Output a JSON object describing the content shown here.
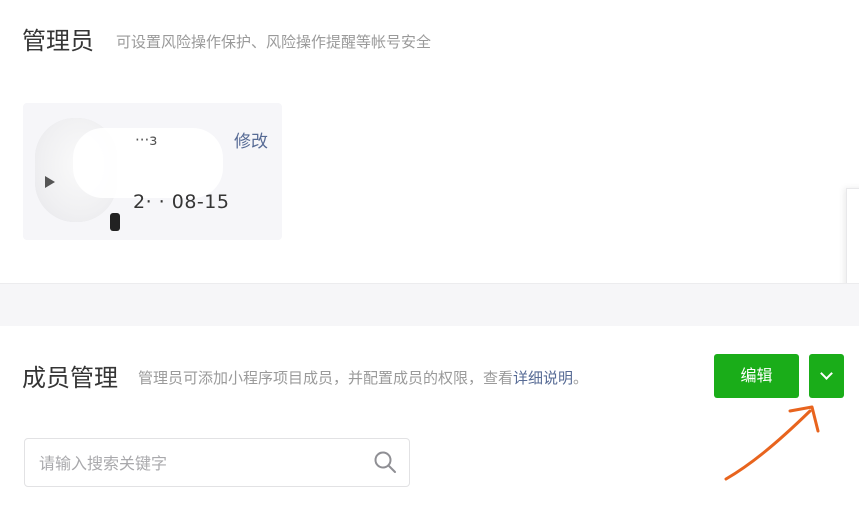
{
  "admin": {
    "title": "管理员",
    "description": "可设置风险操作保护、风险操作提醒等帐号安全",
    "card": {
      "name_fragment": "···з",
      "edit_label": "修改",
      "date_fragment": "2· · 08-15"
    }
  },
  "members": {
    "title": "成员管理",
    "description": "管理员可添加小程序项目成员，并配置成员的权限，查看",
    "description_link": "详细说明",
    "description_end": "。",
    "edit_button": "编辑",
    "search": {
      "placeholder": "请输入搜索关键字",
      "value": ""
    }
  },
  "colors": {
    "primary_green": "#1aad19",
    "link_blue": "#576b95",
    "annotation_orange": "#e8641e"
  },
  "icons": {
    "search": "search-icon",
    "dropdown": "chevron-down-icon"
  }
}
